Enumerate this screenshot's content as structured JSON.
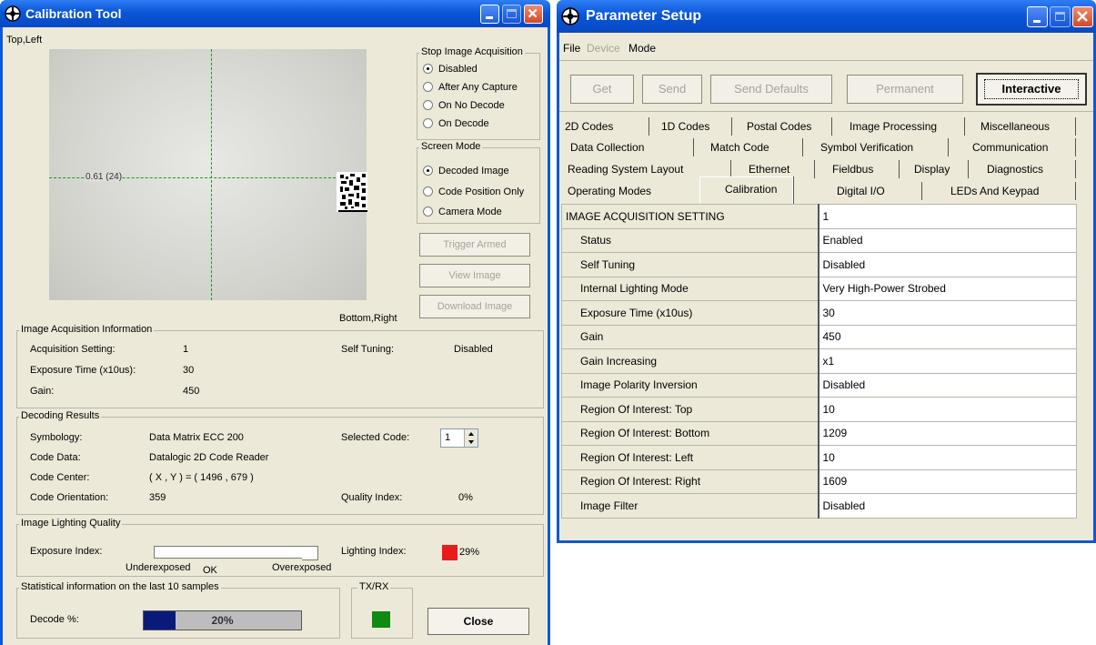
{
  "calibration": {
    "title": "Calibration Tool",
    "top_left": "Top,Left",
    "bottom_right": "Bottom,Right",
    "image_overlay": "0.61 (24)",
    "stop_acq": {
      "label": "Stop Image Acquisition",
      "options": [
        "Disabled",
        "After Any Capture",
        "On No Decode",
        "On Decode"
      ],
      "selected": "Disabled"
    },
    "screen_mode": {
      "label": "Screen Mode",
      "options": [
        "Decoded Image",
        "Code Position Only",
        "Camera Mode"
      ],
      "selected": "Decoded Image"
    },
    "buttons": {
      "trigger": "Trigger Armed",
      "view": "View Image",
      "download": "Download Image",
      "close": "Close"
    },
    "acq_info": {
      "label": "Image Acquisition Information",
      "setting_label": "Acquisition Setting:",
      "setting_value": "1",
      "exposure_label": "Exposure Time (x10us):",
      "exposure_value": "30",
      "gain_label": "Gain:",
      "gain_value": "450",
      "self_tuning_label": "Self Tuning:",
      "self_tuning_value": "Disabled"
    },
    "decoding": {
      "label": "Decoding Results",
      "symbology_label": "Symbology:",
      "symbology_value": "Data Matrix ECC 200",
      "data_label": "Code Data:",
      "data_value": "Datalogic 2D Code Reader",
      "center_label": "Code Center:",
      "center_value": "( X , Y ) = ( 1496 , 679 )",
      "orientation_label": "Code Orientation:",
      "orientation_value": "359",
      "selected_label": "Selected Code:",
      "selected_value": "1",
      "quality_label": "Quality Index:",
      "quality_value": "0%"
    },
    "lighting": {
      "label": "Image Lighting Quality",
      "exposure_index_label": "Exposure Index:",
      "under": "Underexposed",
      "ok": "OK",
      "over": "Overexposed",
      "lighting_index_label": "Lighting Index:",
      "lighting_index_value": "29%",
      "lighting_color": "#e81c1c"
    },
    "stats": {
      "label": "Statistical information on the last 10 samples",
      "decode_label": "Decode %:",
      "decode_value": "20%",
      "decode_fraction": 0.2,
      "bar_color": "#0a1a7a"
    },
    "txrx": {
      "label": "TX/RX",
      "color": "#0f8a12"
    }
  },
  "param": {
    "title": "Parameter Setup",
    "menu": [
      "File",
      "Device",
      "Mode"
    ],
    "toolbar": [
      "Get",
      "Send",
      "Send Defaults",
      "Permanent",
      "Interactive"
    ],
    "tab_rows": [
      [
        "2D Codes",
        "1D Codes",
        "Postal Codes",
        "Image Processing",
        "Miscellaneous"
      ],
      [
        "Data Collection",
        "Match Code",
        "Symbol Verification",
        "Communication"
      ],
      [
        "Reading System Layout",
        "Ethernet",
        "Fieldbus",
        "Display",
        "Diagnostics"
      ],
      [
        "Operating Modes",
        "Calibration",
        "Digital I/O",
        "LEDs And Keypad"
      ]
    ],
    "active_tab": "Calibration",
    "rows": [
      [
        "IMAGE ACQUISITION SETTING",
        "1"
      ],
      [
        "Status",
        "Enabled"
      ],
      [
        "Self Tuning",
        "Disabled"
      ],
      [
        "Internal Lighting Mode",
        "Very High-Power Strobed"
      ],
      [
        "Exposure Time (x10us)",
        "30"
      ],
      [
        "Gain",
        "450"
      ],
      [
        "Gain Increasing",
        "x1"
      ],
      [
        "Image Polarity Inversion",
        "Disabled"
      ],
      [
        "Region Of Interest: Top",
        "10"
      ],
      [
        "Region Of Interest: Bottom",
        "1209"
      ],
      [
        "Region Of Interest: Left",
        "10"
      ],
      [
        "Region Of Interest: Right",
        "1609"
      ],
      [
        "Image Filter",
        "Disabled"
      ]
    ]
  }
}
